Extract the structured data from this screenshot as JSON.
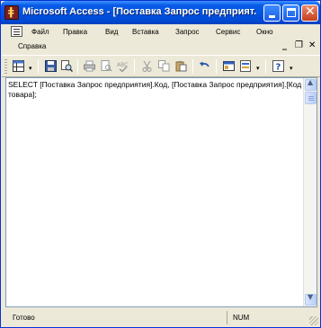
{
  "window": {
    "title": "Microsoft Access - [Поставка Запрос предприят...",
    "icon": "access-key-icon"
  },
  "menu": {
    "items": [
      "Файл",
      "Правка",
      "Вид",
      "Вставка",
      "Запрос",
      "Сервис",
      "Окно"
    ],
    "second_row": [
      "Справка"
    ],
    "mdi_controls": [
      "_",
      "❐",
      "✕"
    ]
  },
  "toolbar": {
    "icons": [
      "datasheet-view-icon",
      "save-icon",
      "search-icon",
      "print-icon",
      "print-preview-icon",
      "spelling-icon",
      "cut-icon",
      "copy-icon",
      "paste-icon",
      "undo-icon",
      "database-window-icon",
      "new-object-icon",
      "help-icon"
    ]
  },
  "editor": {
    "sql": "SELECT [Поставка Запрос предприятия].Код, [Поставка Запрос предприятия].[Код товара];"
  },
  "status": {
    "left": "Готово",
    "right": "NUM"
  },
  "colors": {
    "titlebar": "#0054e3",
    "chrome": "#ece9d8"
  }
}
